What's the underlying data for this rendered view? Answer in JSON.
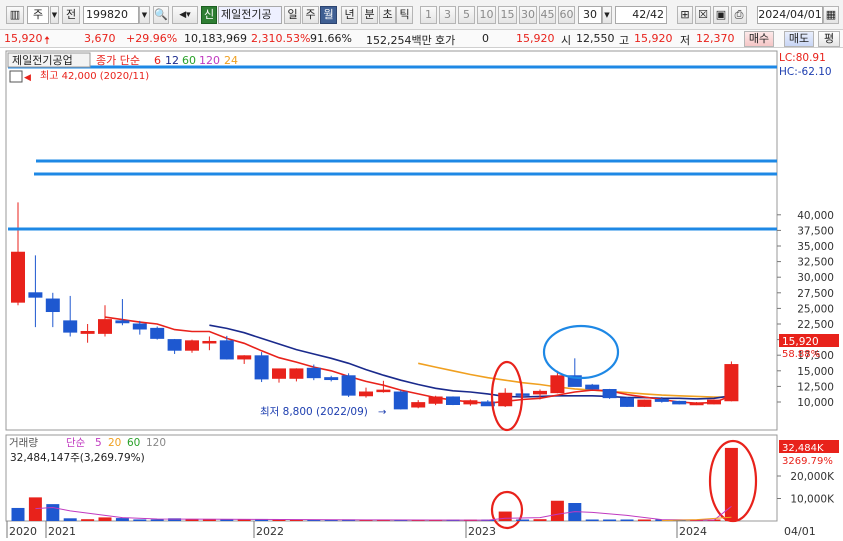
{
  "toolbar": {
    "mode_label": "주",
    "prefix_label": "전",
    "code_value": "199820",
    "new_badge": "신",
    "stock_name": "제일전기공",
    "period_tabs": [
      "일",
      "주",
      "월",
      "년",
      "분",
      "초",
      "틱"
    ],
    "period_selected": "월",
    "interval_tabs": [
      "1",
      "3",
      "5",
      "10",
      "15",
      "30",
      "45",
      "60"
    ],
    "interval_value": "30",
    "count_value": "42",
    "count_total": "/42",
    "date_value": "2024/04/01"
  },
  "infobar": {
    "price": "15,920",
    "change": "3,670",
    "change_pct": "+29.96%",
    "volume": "10,183,969",
    "volume_ratio": "2,310.53%",
    "turnover": "91.66%",
    "trade_amount": "152,254백만",
    "quote_label": "호가",
    "quote_value": "0",
    "current": "15,920",
    "open_label": "시",
    "open": "12,550",
    "high_label": "고",
    "high": "15,920",
    "low_label": "저",
    "low": "12,370",
    "buy_label": "매수",
    "sell_label": "매도",
    "eval_label": "평"
  },
  "price_panel": {
    "stock_label": "제일전기공업",
    "ma_title": "종가 단순",
    "ma_periods": [
      "6",
      "12",
      "60",
      "120",
      "24"
    ],
    "ma_colors": [
      "#e8221b",
      "#1a2a8c",
      "#2aa12a",
      "#c03ac0",
      "#f0a020"
    ],
    "high_note": "최고 42,000 (2020/11)",
    "low_note": "최저 8,800 (2022/09)",
    "lc_label": "LC:80.91",
    "hc_label": "HC:-62.10",
    "current_tag": "15,920",
    "current_pct_tag": "58.88%",
    "ticks": [
      "40,000",
      "37,500",
      "35,000",
      "32,500",
      "30,000",
      "27,500",
      "25,000",
      "22,500",
      "20,000",
      "17,500",
      "15,000",
      "12,500",
      "10,000"
    ]
  },
  "volume_panel": {
    "title": "거래량",
    "ma_title": "단순",
    "ma_periods": [
      "5",
      "20",
      "60",
      "120"
    ],
    "ma_colors": [
      "#c03ac0",
      "#f0a020",
      "#2aa12a",
      "#888888"
    ],
    "value_note": "32,484,147주(3,269.79%)",
    "current_tag": "32,484K",
    "current_pct_tag": "3269.79%",
    "ticks": [
      "20,000K",
      "10,000K"
    ]
  },
  "time_axis": {
    "labels": [
      "2020",
      "2021",
      "2022",
      "2023",
      "2024"
    ],
    "end_label": "04/01"
  },
  "colors": {
    "up": "#e8221b",
    "down": "#1e58d0",
    "annotation_line": "#1e88e5",
    "circle_red": "#e8221b",
    "circle_blue": "#1e88e5"
  },
  "chart_data": {
    "type": "candlestick",
    "period": "monthly",
    "price_axis": {
      "min": 8500,
      "max": 42500,
      "ticks": [
        10000,
        12500,
        15000,
        17500,
        20000,
        22500,
        25000,
        27500,
        30000,
        32500,
        35000,
        37500,
        40000
      ]
    },
    "candles": [
      {
        "date": "2020/10",
        "open": 26000,
        "high": 42000,
        "low": 25500,
        "close": 34000
      },
      {
        "date": "2020/12",
        "open": 27500,
        "high": 33500,
        "low": 22000,
        "close": 26800
      },
      {
        "date": "2021/01",
        "open": 26500,
        "high": 27500,
        "low": 22000,
        "close": 24500
      },
      {
        "date": "2021/02",
        "open": 23000,
        "high": 27000,
        "low": 20500,
        "close": 21200
      },
      {
        "date": "2021/03",
        "open": 21000,
        "high": 22500,
        "low": 19500,
        "close": 21300
      },
      {
        "date": "2021/04",
        "open": 21000,
        "high": 25500,
        "low": 20500,
        "close": 23200
      },
      {
        "date": "2021/05",
        "open": 23000,
        "high": 26500,
        "low": 22300,
        "close": 22700
      },
      {
        "date": "2021/06",
        "open": 22500,
        "high": 23000,
        "low": 20800,
        "close": 21700
      },
      {
        "date": "2021/07",
        "open": 21800,
        "high": 22100,
        "low": 20000,
        "close": 20200
      },
      {
        "date": "2021/08",
        "open": 20000,
        "high": 20100,
        "low": 17700,
        "close": 18300
      },
      {
        "date": "2021/09",
        "open": 18300,
        "high": 20000,
        "low": 17900,
        "close": 19800
      },
      {
        "date": "2021/10",
        "open": 19500,
        "high": 20500,
        "low": 18300,
        "close": 19700
      },
      {
        "date": "2021/11",
        "open": 19800,
        "high": 20600,
        "low": 16800,
        "close": 16900
      },
      {
        "date": "2021/12",
        "open": 16900,
        "high": 17500,
        "low": 16100,
        "close": 17400
      },
      {
        "date": "2022/01",
        "open": 17400,
        "high": 18000,
        "low": 13200,
        "close": 13700
      },
      {
        "date": "2022/02",
        "open": 13800,
        "high": 15000,
        "low": 13100,
        "close": 15300
      },
      {
        "date": "2022/03",
        "open": 13800,
        "high": 15400,
        "low": 13300,
        "close": 15300
      },
      {
        "date": "2022/04",
        "open": 15400,
        "high": 16000,
        "low": 13500,
        "close": 13900
      },
      {
        "date": "2022/05",
        "open": 13900,
        "high": 14200,
        "low": 13300,
        "close": 13600
      },
      {
        "date": "2022/06",
        "open": 14200,
        "high": 14600,
        "low": 10800,
        "close": 11100
      },
      {
        "date": "2022/07",
        "open": 11000,
        "high": 12300,
        "low": 10700,
        "close": 11600
      },
      {
        "date": "2022/08",
        "open": 11800,
        "high": 13400,
        "low": 11500,
        "close": 11900
      },
      {
        "date": "2022/09",
        "open": 11600,
        "high": 11900,
        "low": 8800,
        "close": 8900
      },
      {
        "date": "2022/10",
        "open": 9200,
        "high": 10300,
        "low": 9000,
        "close": 9900
      },
      {
        "date": "2022/11",
        "open": 9800,
        "high": 11000,
        "low": 9500,
        "close": 10800
      },
      {
        "date": "2022/12",
        "open": 10800,
        "high": 10900,
        "low": 9500,
        "close": 9600
      },
      {
        "date": "2023/01",
        "open": 9700,
        "high": 10400,
        "low": 9400,
        "close": 10200
      },
      {
        "date": "2023/02",
        "open": 10000,
        "high": 10300,
        "low": 9400,
        "close": 9400
      },
      {
        "date": "2023/03",
        "open": 9400,
        "high": 12200,
        "low": 9200,
        "close": 11400
      },
      {
        "date": "2023/04",
        "open": 11300,
        "high": 12000,
        "low": 10900,
        "close": 11100
      },
      {
        "date": "2023/05",
        "open": 11300,
        "high": 12000,
        "low": 10400,
        "close": 11700
      },
      {
        "date": "2023/06",
        "open": 11500,
        "high": 15000,
        "low": 11400,
        "close": 14200
      },
      {
        "date": "2023/07",
        "open": 14200,
        "high": 17000,
        "low": 12500,
        "close": 12500
      },
      {
        "date": "2023/08",
        "open": 12700,
        "high": 12900,
        "low": 12000,
        "close": 12100
      },
      {
        "date": "2023/09",
        "open": 12000,
        "high": 12100,
        "low": 10500,
        "close": 10700
      },
      {
        "date": "2023/10",
        "open": 10600,
        "high": 10800,
        "low": 9200,
        "close": 9300
      },
      {
        "date": "2023/11",
        "open": 9300,
        "high": 10400,
        "low": 9200,
        "close": 10300
      },
      {
        "date": "2023/12",
        "open": 10400,
        "high": 10800,
        "low": 9900,
        "close": 10100
      },
      {
        "date": "2024/01",
        "open": 10100,
        "high": 10200,
        "low": 9600,
        "close": 9700
      },
      {
        "date": "2024/02",
        "open": 9700,
        "high": 10000,
        "low": 9500,
        "close": 9800
      },
      {
        "date": "2024/03",
        "open": 9700,
        "high": 10400,
        "low": 9600,
        "close": 10300
      },
      {
        "date": "2024/04",
        "open": 10200,
        "high": 16500,
        "low": 10100,
        "close": 16000
      }
    ],
    "ma6_path": [
      [
        5,
        23600
      ],
      [
        6,
        23200
      ],
      [
        7,
        22800
      ],
      [
        8,
        22500
      ],
      [
        9,
        21600
      ],
      [
        10,
        21300
      ],
      [
        11,
        21300
      ],
      [
        12,
        20200
      ],
      [
        13,
        19400
      ],
      [
        14,
        18200
      ],
      [
        15,
        17100
      ],
      [
        16,
        16400
      ],
      [
        17,
        15600
      ],
      [
        18,
        15000
      ],
      [
        19,
        14100
      ],
      [
        20,
        13300
      ],
      [
        21,
        12700
      ],
      [
        22,
        11900
      ],
      [
        23,
        11300
      ],
      [
        24,
        10700
      ],
      [
        25,
        10300
      ],
      [
        26,
        10000
      ],
      [
        27,
        9800
      ],
      [
        28,
        10100
      ],
      [
        29,
        10400
      ],
      [
        30,
        10600
      ],
      [
        31,
        11100
      ],
      [
        32,
        11600
      ],
      [
        33,
        11900
      ],
      [
        34,
        11800
      ],
      [
        35,
        11200
      ],
      [
        36,
        10800
      ],
      [
        37,
        10400
      ],
      [
        38,
        10000
      ],
      [
        39,
        9800
      ],
      [
        40,
        9900
      ],
      [
        41,
        11000
      ]
    ],
    "ma12_path": [
      [
        11,
        22300
      ],
      [
        12,
        21800
      ],
      [
        13,
        21100
      ],
      [
        14,
        20200
      ],
      [
        15,
        19300
      ],
      [
        16,
        18400
      ],
      [
        17,
        17700
      ],
      [
        18,
        17000
      ],
      [
        19,
        16200
      ],
      [
        20,
        15200
      ],
      [
        21,
        14300
      ],
      [
        22,
        13500
      ],
      [
        23,
        12800
      ],
      [
        24,
        12200
      ],
      [
        25,
        11800
      ],
      [
        26,
        11600
      ],
      [
        27,
        11300
      ],
      [
        28,
        10900
      ],
      [
        29,
        10800
      ],
      [
        30,
        10900
      ],
      [
        31,
        11000
      ],
      [
        32,
        11000
      ],
      [
        33,
        11000
      ],
      [
        34,
        10900
      ],
      [
        35,
        10700
      ],
      [
        36,
        10700
      ],
      [
        37,
        10600
      ],
      [
        38,
        10600
      ],
      [
        39,
        10500
      ],
      [
        40,
        10600
      ],
      [
        41,
        11000
      ]
    ],
    "ma24_path": [
      [
        23,
        16200
      ],
      [
        24,
        15600
      ],
      [
        25,
        15000
      ],
      [
        26,
        14400
      ],
      [
        27,
        13900
      ],
      [
        28,
        13500
      ],
      [
        29,
        13100
      ],
      [
        30,
        12800
      ],
      [
        31,
        12400
      ],
      [
        32,
        12100
      ],
      [
        33,
        11900
      ],
      [
        34,
        11700
      ],
      [
        35,
        11500
      ],
      [
        36,
        11300
      ],
      [
        37,
        11100
      ],
      [
        38,
        11000
      ],
      [
        39,
        10900
      ],
      [
        40,
        10800
      ],
      [
        41,
        10800
      ]
    ],
    "volume_axis": {
      "min": 0,
      "max": 38000,
      "ticks": [
        10000,
        20000
      ]
    },
    "volume": [
      {
        "i": 0,
        "v": 5800,
        "up": false
      },
      {
        "i": 1,
        "v": 10500,
        "up": true
      },
      {
        "i": 2,
        "v": 7500,
        "up": false
      },
      {
        "i": 3,
        "v": 1200,
        "up": false
      },
      {
        "i": 4,
        "v": 800,
        "up": true
      },
      {
        "i": 5,
        "v": 1600,
        "up": true
      },
      {
        "i": 6,
        "v": 1300,
        "up": false
      },
      {
        "i": 7,
        "v": 700,
        "up": false
      },
      {
        "i": 8,
        "v": 700,
        "up": false
      },
      {
        "i": 9,
        "v": 1200,
        "up": false
      },
      {
        "i": 10,
        "v": 900,
        "up": true
      },
      {
        "i": 11,
        "v": 700,
        "up": true
      },
      {
        "i": 12,
        "v": 800,
        "up": false
      },
      {
        "i": 13,
        "v": 500,
        "up": true
      },
      {
        "i": 14,
        "v": 900,
        "up": false
      },
      {
        "i": 15,
        "v": 600,
        "up": true
      },
      {
        "i": 16,
        "v": 500,
        "up": true
      },
      {
        "i": 17,
        "v": 500,
        "up": false
      },
      {
        "i": 18,
        "v": 400,
        "up": false
      },
      {
        "i": 19,
        "v": 700,
        "up": false
      },
      {
        "i": 20,
        "v": 300,
        "up": true
      },
      {
        "i": 21,
        "v": 400,
        "up": true
      },
      {
        "i": 22,
        "v": 500,
        "up": false
      },
      {
        "i": 23,
        "v": 300,
        "up": true
      },
      {
        "i": 24,
        "v": 300,
        "up": true
      },
      {
        "i": 25,
        "v": 300,
        "up": false
      },
      {
        "i": 26,
        "v": 300,
        "up": true
      },
      {
        "i": 27,
        "v": 200,
        "up": false
      },
      {
        "i": 28,
        "v": 4200,
        "up": true
      },
      {
        "i": 29,
        "v": 500,
        "up": false
      },
      {
        "i": 30,
        "v": 800,
        "up": true
      },
      {
        "i": 31,
        "v": 9000,
        "up": true
      },
      {
        "i": 32,
        "v": 8000,
        "up": false
      },
      {
        "i": 33,
        "v": 600,
        "up": false
      },
      {
        "i": 34,
        "v": 400,
        "up": false
      },
      {
        "i": 35,
        "v": 300,
        "up": false
      },
      {
        "i": 36,
        "v": 200,
        "up": true
      },
      {
        "i": 37,
        "v": 200,
        "up": false
      },
      {
        "i": 38,
        "v": 200,
        "up": false
      },
      {
        "i": 39,
        "v": 200,
        "up": true
      },
      {
        "i": 40,
        "v": 400,
        "up": true
      },
      {
        "i": 41,
        "v": 32484,
        "up": true
      }
    ]
  }
}
